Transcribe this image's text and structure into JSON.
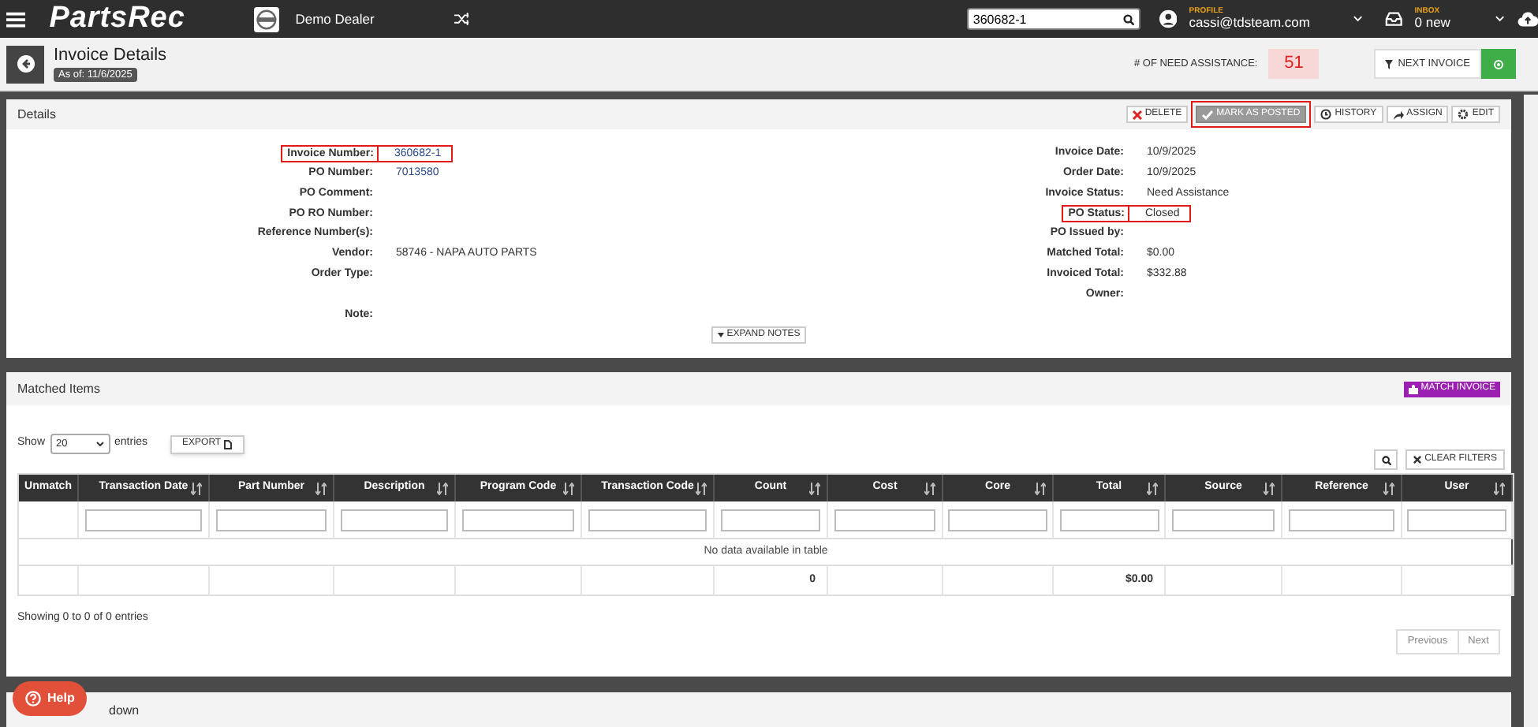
{
  "nav": {
    "brand": "PartsRec",
    "dealer": "Demo Dealer",
    "search": {
      "value": "360682-1"
    },
    "profile": {
      "caption": "PROFILE",
      "email": "cassi@tdsteam.com"
    },
    "inbox": {
      "caption": "INBOX",
      "count": "0 new"
    }
  },
  "header": {
    "title": "Invoice Details",
    "as_of": "As of: 11/6/2025",
    "need_assistance_label": "# OF NEED ASSISTANCE:",
    "need_assistance_count": "51",
    "next_button": "NEXT INVOICE"
  },
  "details": {
    "title": "Details",
    "actions": [
      {
        "label": "DELETE",
        "kind": "delete",
        "highlighted": false,
        "disabled": false
      },
      {
        "label": "MARK AS POSTED",
        "kind": "posted",
        "highlighted": true,
        "disabled": true
      },
      {
        "label": "HISTORY",
        "kind": "history",
        "highlighted": false,
        "disabled": false
      },
      {
        "label": "ASSIGN",
        "kind": "assign",
        "highlighted": false,
        "disabled": false
      },
      {
        "label": "EDIT",
        "kind": "edit",
        "highlighted": false,
        "disabled": false
      }
    ],
    "left_fields": [
      {
        "label": "Invoice Number:",
        "value": "360682-1",
        "link": true,
        "highlighted": true
      },
      {
        "label": "PO Number:",
        "value": "7013580",
        "link": true,
        "highlighted": false
      },
      {
        "label": "PO Comment:",
        "highlighted": false
      },
      {
        "label": "PO RO Number:",
        "highlighted": false
      },
      {
        "label": "Reference Number(s):",
        "highlighted": false
      },
      {
        "label": "Vendor:",
        "value": "58746 - NAPA AUTO PARTS",
        "link": false,
        "highlighted": false
      },
      {
        "label": "Order Type:",
        "highlighted": false
      }
    ],
    "note": {
      "label": "Note:"
    },
    "right_fields": [
      {
        "label": "Invoice Date:",
        "value": "10/9/2025",
        "highlighted": false
      },
      {
        "label": "Order Date:",
        "value": "10/9/2025",
        "highlighted": false
      },
      {
        "label": "Invoice Status:",
        "value": "Need Assistance",
        "highlighted": false
      },
      {
        "label": "PO Status:",
        "value": "Closed",
        "highlighted": true
      },
      {
        "label": "PO Issued by:",
        "highlighted": false
      },
      {
        "label": "Matched Total:",
        "value": "$0.00",
        "highlighted": false
      },
      {
        "label": "Invoiced Total:",
        "value": "$332.88",
        "highlighted": false
      },
      {
        "label": "Owner:",
        "highlighted": false
      }
    ],
    "expand_button": "EXPAND NOTES"
  },
  "matched": {
    "title": "Matched Items",
    "match_button": "MATCH INVOICE",
    "show_label": "Show",
    "page_size": "20",
    "entries_label": "entries",
    "export_button": "EXPORT",
    "clear_filters": "CLEAR FILTERS",
    "columns": [
      {
        "label": "Unmatch",
        "sortable": false
      },
      {
        "label": "Transaction Date",
        "sortable": true
      },
      {
        "label": "Part Number",
        "sortable": true
      },
      {
        "label": "Description",
        "sortable": true
      },
      {
        "label": "Program Code",
        "sortable": true
      },
      {
        "label": "Transaction Code",
        "sortable": true
      },
      {
        "label": "Count",
        "sortable": true
      },
      {
        "label": "Cost",
        "sortable": true
      },
      {
        "label": "Core",
        "sortable": true
      },
      {
        "label": "Total",
        "sortable": true
      },
      {
        "label": "Source",
        "sortable": true
      },
      {
        "label": "Reference",
        "sortable": true
      },
      {
        "label": "User",
        "sortable": true
      }
    ],
    "empty_message": "No data available in table",
    "footer_count": "0",
    "footer_total": "$0.00",
    "info": "Showing 0 to 0 of 0 entries",
    "pagination": [
      {
        "label": "Previous"
      },
      {
        "label": "Next"
      }
    ]
  },
  "breakdown": {
    "title": "down"
  },
  "help_button": "Help"
}
